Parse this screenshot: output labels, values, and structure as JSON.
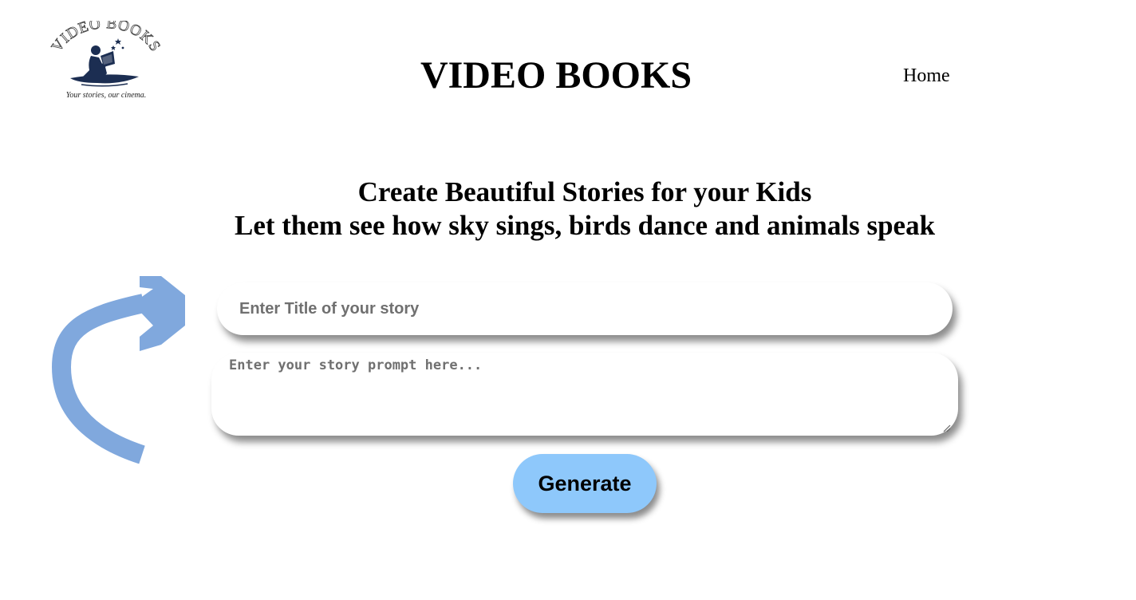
{
  "header": {
    "logo": {
      "brand_text": "VIDEO BOOKS",
      "tagline": "Your stories, our cinema.",
      "icon": "reading-child-icon"
    },
    "title": "VIDEO BOOKS",
    "nav": {
      "home_label": "Home"
    }
  },
  "hero": {
    "line1": "Create Beautiful Stories for your Kids",
    "line2": "Let them see how sky sings, birds dance and animals speak"
  },
  "form": {
    "title_placeholder": "Enter Title of your story",
    "title_value": "",
    "prompt_placeholder": "Enter your story prompt here...",
    "prompt_value": "",
    "generate_label": "Generate"
  },
  "decor": {
    "arrow_icon": "curved-arrow-icon",
    "arrow_color": "#80a8dd"
  },
  "colors": {
    "button_bg": "#8ec8fb",
    "logo_navy": "#1c2e52"
  }
}
